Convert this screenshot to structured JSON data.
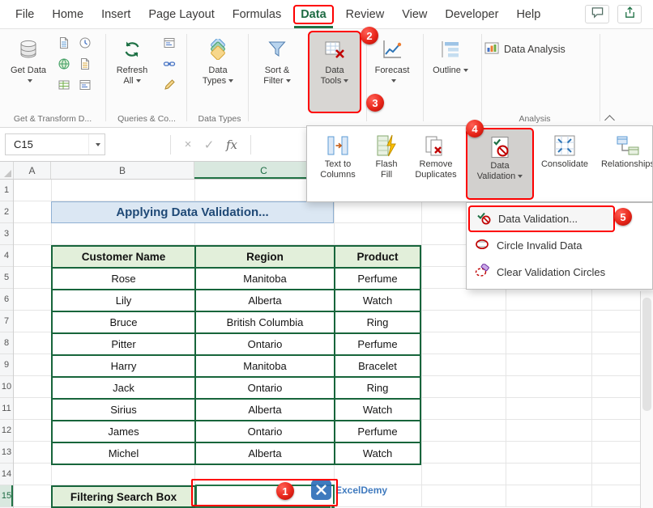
{
  "menu_bar": {
    "items": [
      "File",
      "Home",
      "Insert",
      "Page Layout",
      "Formulas",
      "Data",
      "Review",
      "View",
      "Developer",
      "Help"
    ],
    "active_tab": "Data"
  },
  "ribbon": {
    "buttons": {
      "get_data": "Get Data",
      "refresh_all": "Refresh All",
      "data_types": "Data Types",
      "sort_filter": "Sort & Filter",
      "data_tools": "Data Tools",
      "forecast": "Forecast",
      "outline": "Outline",
      "data_analysis": "Data Analysis"
    },
    "group_labels": [
      "Get & Transform D...",
      "Queries & Co...",
      "Data Types",
      "Analysis"
    ]
  },
  "formula_bar": {
    "name_box": "C15",
    "cancel_icon": "×",
    "enter_icon": "✓",
    "fx_icon": "fx",
    "formula": ""
  },
  "data_tools_menu": {
    "items": [
      "Text to Columns",
      "Flash Fill",
      "Remove Duplicates",
      "Data Validation",
      "Consolidate",
      "Relationships"
    ],
    "active_item": "Data Validation"
  },
  "validation_submenu": {
    "items": [
      "Data Validation...",
      "Circle Invalid Data",
      "Clear Validation Circles"
    ],
    "active_item": "Data Validation..."
  },
  "annotations": {
    "steps": [
      "1",
      "2",
      "3",
      "4",
      "5"
    ]
  },
  "sheet": {
    "column_headers": [
      "A",
      "B",
      "C"
    ],
    "row_headers": [
      "1",
      "2",
      "3",
      "4",
      "5",
      "6",
      "7",
      "8",
      "9",
      "10",
      "11",
      "12",
      "13",
      "14",
      "15"
    ],
    "selected_cell": "C15",
    "title": "Applying Data Validation...",
    "table": {
      "headers": [
        "Customer Name",
        "Region",
        "Product"
      ],
      "rows": [
        [
          "Rose",
          "Manitoba",
          "Perfume"
        ],
        [
          "Lily",
          "Alberta",
          "Watch"
        ],
        [
          "Bruce",
          "British Columbia",
          "Ring"
        ],
        [
          "Pitter",
          "Ontario",
          "Perfume"
        ],
        [
          "Harry",
          "Manitoba",
          "Bracelet"
        ],
        [
          "Jack",
          "Ontario",
          "Ring"
        ],
        [
          "Sirius",
          "Alberta",
          "Watch"
        ],
        [
          "James",
          "Ontario",
          "Perfume"
        ],
        [
          "Michel",
          "Alberta",
          "Watch"
        ]
      ]
    },
    "footer_label": "Filtering Search Box"
  },
  "watermark": {
    "text": "ExcelDemy"
  },
  "colors": {
    "excel_green": "#217346",
    "annotation_red": "#fe0000",
    "table_header_bg": "#e2efda",
    "table_border": "#17653b",
    "title_bg": "#dbe7f3",
    "title_text": "#1f4976"
  }
}
